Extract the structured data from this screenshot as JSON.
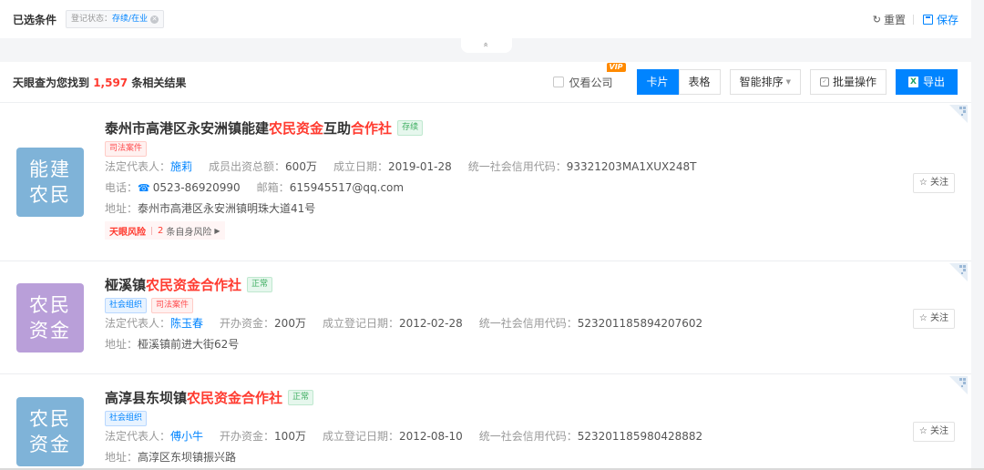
{
  "filter": {
    "title": "已选条件",
    "tag_label": "登记状态：",
    "tag_value": "存续/在业",
    "reset_label": "重置",
    "save_label": "保存"
  },
  "collapse_icon": "»",
  "results": {
    "prefix": "天眼查为您找到",
    "count": "1,597",
    "suffix": "条相关结果",
    "only_company_label": "仅看公司",
    "vip_label": "VIP",
    "view_card": "卡片",
    "view_table": "表格",
    "sort_label": "智能排序",
    "batch_label": "批量操作",
    "export_label": "导出"
  },
  "companies": [
    {
      "logo_line1": "能建",
      "logo_line2": "农民",
      "logo_color": "#7fb3d8",
      "name_a": "泰州市高港区永安洲镇能建",
      "name_b": "农民资金",
      "name_c": "互助",
      "name_d": "合作社",
      "status": "存续",
      "tag1": "司法案件",
      "rep_label": "法定代表人：",
      "rep": "施莉",
      "capital_label": "成员出资总额：",
      "capital": "600万",
      "date_label": "成立日期：",
      "date": "2019-01-28",
      "credit_label": "统一社会信用代码：",
      "credit": "93321203MA1XUX248T",
      "phone_label": "电话：",
      "phone": "0523-86920990",
      "email_label": "邮箱：",
      "email": "615945517@qq.com",
      "addr_label": "地址：",
      "addr": "泰州市高港区永安洲镇明珠大道41号",
      "risk_title": "天眼风险",
      "risk_count": "2",
      "risk_text": "条自身风险",
      "follow": "关注"
    },
    {
      "logo_line1": "农民",
      "logo_line2": "资金",
      "logo_color": "#b99fd9",
      "name_a": "桠溪镇",
      "name_b": "农民资金合作社",
      "status": "正常",
      "tag1": "社会组织",
      "tag2": "司法案件",
      "rep_label": "法定代表人：",
      "rep": "陈玉春",
      "capital_label": "开办资金：",
      "capital": "200万",
      "date_label": "成立登记日期：",
      "date": "2012-02-28",
      "credit_label": "统一社会信用代码：",
      "credit": "523201185894207602",
      "addr_label": "地址：",
      "addr": "桠溪镇前进大街62号",
      "follow": "关注"
    },
    {
      "logo_line1": "农民",
      "logo_line2": "资金",
      "logo_color": "#7fb3d8",
      "name_a": "高淳县东坝镇",
      "name_b": "农民资金合作社",
      "status": "正常",
      "tag1": "社会组织",
      "rep_label": "法定代表人：",
      "rep": "傅小牛",
      "capital_label": "开办资金：",
      "capital": "100万",
      "date_label": "成立登记日期：",
      "date": "2012-08-10",
      "credit_label": "统一社会信用代码：",
      "credit": "523201185980428882",
      "addr_label": "地址：",
      "addr": "高淳区东坝镇振兴路",
      "follow": "关注"
    }
  ],
  "icons": {
    "refresh": "refresh-icon",
    "save": "save-icon",
    "phone": "phone-icon",
    "star": "star-icon",
    "qr": "qrcode-icon"
  }
}
